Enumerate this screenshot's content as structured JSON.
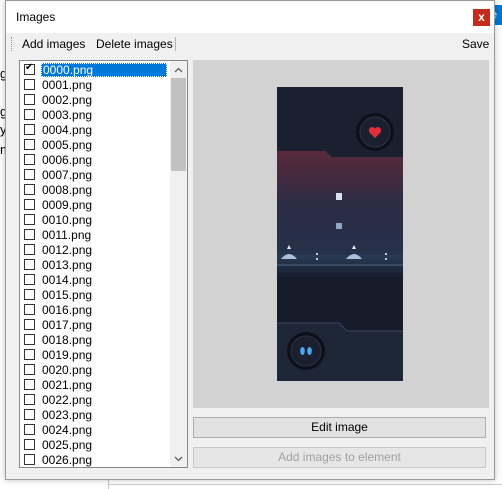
{
  "window": {
    "title": "Images",
    "close_symbol": "x"
  },
  "toolbar": {
    "add_images": "Add images",
    "delete_images": "Delete images",
    "save": "Save"
  },
  "image_list": {
    "items": [
      {
        "label": "0000.png",
        "checked": true,
        "selected": true
      },
      {
        "label": "0001.png",
        "checked": false
      },
      {
        "label": "0002.png",
        "checked": false
      },
      {
        "label": "0003.png",
        "checked": false
      },
      {
        "label": "0004.png",
        "checked": false
      },
      {
        "label": "0005.png",
        "checked": false
      },
      {
        "label": "0006.png",
        "checked": false
      },
      {
        "label": "0007.png",
        "checked": false
      },
      {
        "label": "0008.png",
        "checked": false
      },
      {
        "label": "0009.png",
        "checked": false
      },
      {
        "label": "0010.png",
        "checked": false
      },
      {
        "label": "0011.png",
        "checked": false
      },
      {
        "label": "0012.png",
        "checked": false
      },
      {
        "label": "0013.png",
        "checked": false
      },
      {
        "label": "0014.png",
        "checked": false
      },
      {
        "label": "0015.png",
        "checked": false
      },
      {
        "label": "0016.png",
        "checked": false
      },
      {
        "label": "0017.png",
        "checked": false
      },
      {
        "label": "0018.png",
        "checked": false
      },
      {
        "label": "0019.png",
        "checked": false
      },
      {
        "label": "0020.png",
        "checked": false
      },
      {
        "label": "0021.png",
        "checked": false
      },
      {
        "label": "0022.png",
        "checked": false
      },
      {
        "label": "0023.png",
        "checked": false
      },
      {
        "label": "0024.png",
        "checked": false
      },
      {
        "label": "0025.png",
        "checked": false
      },
      {
        "label": "0026.png",
        "checked": false
      }
    ]
  },
  "buttons": {
    "edit_image": "Edit image",
    "add_images_to_element": "Add images to element"
  },
  "background": {
    "fragment_1": "g",
    "fragment_2": "g",
    "fragment_3": "ys",
    "fragment_4": "m",
    "right_tab_letter": "e"
  },
  "colors": {
    "selection": "#0078d7",
    "close_button": "#c42b1c",
    "preview_bg": "#d2d2d2"
  }
}
